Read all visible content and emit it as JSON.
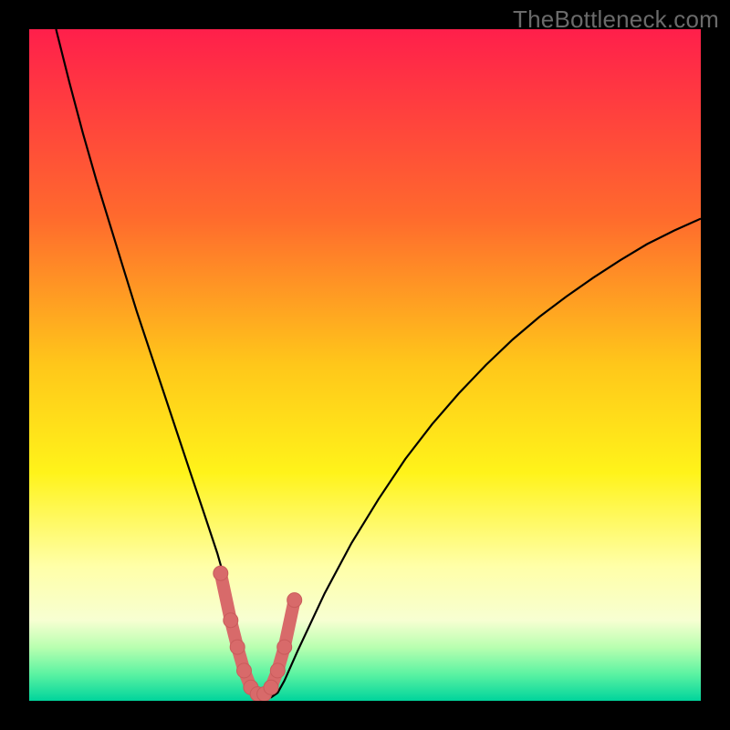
{
  "watermark": "TheBottleneck.com",
  "colors": {
    "frame": "#000000",
    "grad_top": "#ff1f4b",
    "grad_25": "#ff6a2d",
    "grad_45": "#ffc71a",
    "grad_60": "#fff31a",
    "grad_78": "#ffffa8",
    "grad_86": "#f7ffd2",
    "grad_90": "#b9ffb0",
    "grad_94": "#5cf3a2",
    "grad_bottom": "#00d49c",
    "curve": "#000000",
    "marker_fill": "#d86a6a",
    "marker_stroke": "#c95b5b"
  },
  "chart_data": {
    "type": "line",
    "title": "",
    "xlabel": "",
    "ylabel": "",
    "xlim": [
      0,
      100
    ],
    "ylim": [
      0,
      100
    ],
    "series": [
      {
        "name": "bottleneck-curve",
        "x": [
          4,
          6,
          8,
          10,
          12,
          14,
          16,
          18,
          20,
          22,
          24,
          26,
          28,
          29,
          30,
          31,
          32,
          33,
          34,
          35,
          36,
          37,
          38,
          40,
          44,
          48,
          52,
          56,
          60,
          64,
          68,
          72,
          76,
          80,
          84,
          88,
          92,
          96,
          100
        ],
        "y": [
          100,
          92,
          84.5,
          77.5,
          71,
          64.5,
          58,
          52,
          46,
          40,
          34,
          28,
          22,
          18.5,
          14.5,
          10,
          6,
          3,
          1.2,
          0.5,
          0.5,
          1.2,
          3,
          7.5,
          16,
          23.5,
          30,
          36,
          41.2,
          45.8,
          50,
          53.8,
          57.2,
          60.2,
          63,
          65.6,
          68,
          70,
          71.8
        ]
      }
    ],
    "markers": {
      "name": "highlight-region",
      "x": [
        28.5,
        30,
        31,
        32,
        33,
        34,
        35,
        36,
        37,
        38,
        39.5
      ],
      "y": [
        19,
        12,
        8,
        4.5,
        2,
        1,
        1,
        2,
        4.5,
        8,
        15
      ]
    }
  }
}
